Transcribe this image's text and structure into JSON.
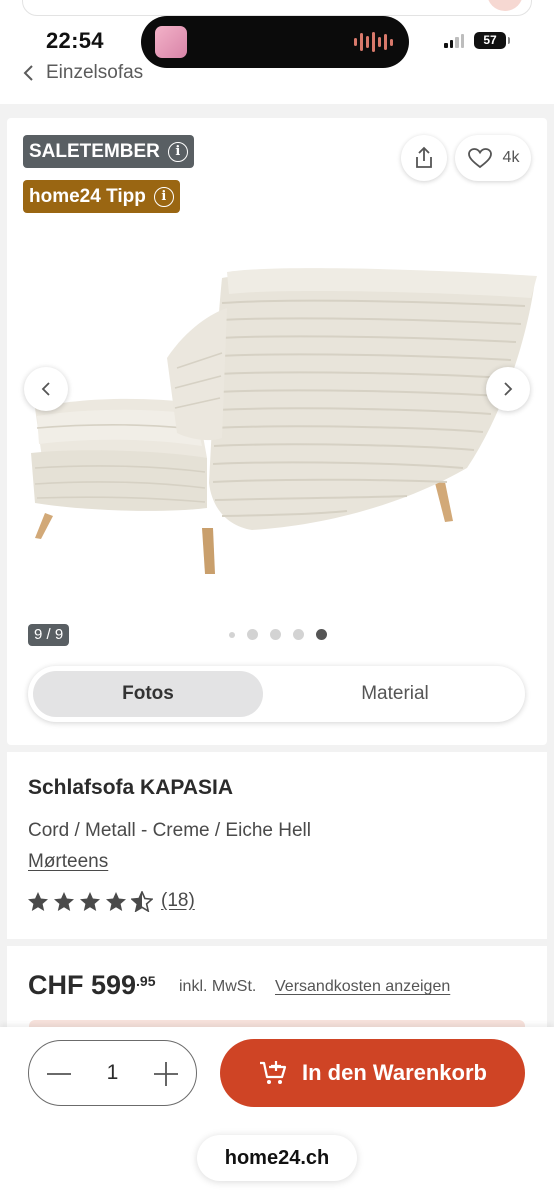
{
  "status_bar": {
    "time": "22:54",
    "battery": "57"
  },
  "nav": {
    "back_label": "Einzelsofas"
  },
  "gallery": {
    "badges": [
      {
        "label": "SALETEMBER",
        "color": "#595f63"
      },
      {
        "label": "home24 Tipp",
        "color": "#9a6612"
      }
    ],
    "info_icon": "i",
    "favorites_count": "4k",
    "image_counter": "9 / 9",
    "dots_total": 5,
    "active_dot": 5,
    "tabs": [
      {
        "label": "Fotos",
        "active": true
      },
      {
        "label": "Material",
        "active": false
      }
    ]
  },
  "product": {
    "title": "Schlafsofa KAPASIA",
    "subtitle": "Cord / Metall - Creme / Eiche Hell",
    "brand": "Mørteens",
    "rating": 4.5,
    "review_count": "(18)"
  },
  "price": {
    "main": "CHF 599",
    "cents": ".95",
    "vat": "inkl. MwSt.",
    "shipping_link": "Versandkosten anzeigen"
  },
  "purchase": {
    "quantity": "1",
    "cart_label": "In den Warenkorb",
    "accent_color": "#cf4425"
  },
  "browser": {
    "url": "home24.ch"
  }
}
